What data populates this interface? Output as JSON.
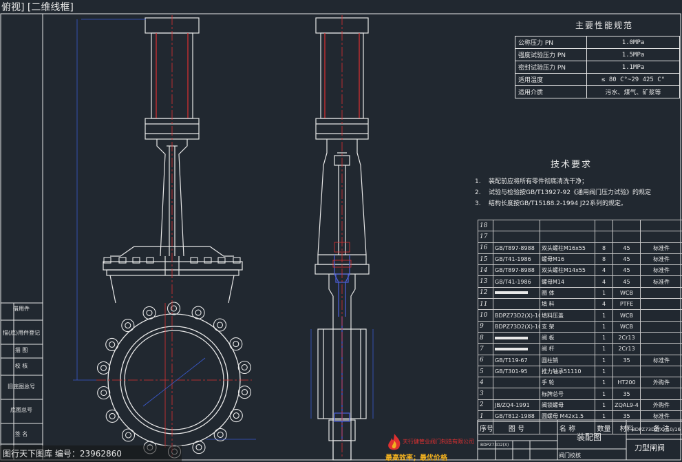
{
  "viewport_label": "俯视] [二维线框]",
  "spec_table": {
    "title": "主要性能规范",
    "rows": [
      {
        "label": "公称压力  PN",
        "value": "1.0MPa"
      },
      {
        "label": "强度试验压力 PN",
        "value": "1.5MPa"
      },
      {
        "label": "密封试验压力 PN",
        "value": "1.1MPa"
      },
      {
        "label": "适用温度",
        "value": "≤ 80 C°~29  425 C°"
      },
      {
        "label": "适用介质",
        "value": "污水、煤气、矿浆等"
      }
    ]
  },
  "tech": {
    "title": "技术要求",
    "items": [
      {
        "n": "1.",
        "text": "装配前应将所有零件彻底清洗干净；"
      },
      {
        "n": "2.",
        "text": "试验与检验按GB/T13927-92《通用阀门压力试验》的规定"
      },
      {
        "n": "3.",
        "text": "结构长度按GB/T15188.2-1994 J22系列的规定。"
      }
    ]
  },
  "bom": {
    "rows": [
      {
        "no": "18",
        "code": "",
        "name": "",
        "qty": "",
        "mat": "",
        "note": ""
      },
      {
        "no": "17",
        "code": "",
        "name": "",
        "qty": "",
        "mat": "",
        "note": ""
      },
      {
        "no": "16",
        "code": "GB/T897-8988",
        "name": "双头螺柱M16x55",
        "qty": "8",
        "mat": "45",
        "note": "标准件"
      },
      {
        "no": "15",
        "code": "GB/T41-1986",
        "name": "螺母M16",
        "qty": "8",
        "mat": "45",
        "note": "标准件"
      },
      {
        "no": "14",
        "code": "GB/T897-8988",
        "name": "双头螺柱M14x55",
        "qty": "4",
        "mat": "45",
        "note": "标准件"
      },
      {
        "no": "13",
        "code": "GB/T41-1986",
        "name": "螺母M14",
        "qty": "4",
        "mat": "45",
        "note": "标准件"
      },
      {
        "no": "12",
        "code": "",
        "name": "圈  体",
        "qty": "1",
        "mat": "WCB",
        "note": ""
      },
      {
        "no": "11",
        "code": "",
        "name": "填  料",
        "qty": "4",
        "mat": "PTFE",
        "note": ""
      },
      {
        "no": "10",
        "code": "BDPZ73D2(X)-10/16",
        "name": "填料压盖",
        "qty": "1",
        "mat": "WCB",
        "note": ""
      },
      {
        "no": "9",
        "code": "BDPZ73D2(X)-10/16",
        "name": "支  架",
        "qty": "1",
        "mat": "WCB",
        "note": ""
      },
      {
        "no": "8",
        "code": "",
        "name": "阀  板",
        "qty": "1",
        "mat": "2Cr13",
        "note": ""
      },
      {
        "no": "7",
        "code": "",
        "name": "阀  杆",
        "qty": "1",
        "mat": "2Cr13",
        "note": ""
      },
      {
        "no": "6",
        "code": "GB/T119-67",
        "name": "圆柱销",
        "qty": "1",
        "mat": "35",
        "note": "标准件"
      },
      {
        "no": "5",
        "code": "GB/T301-95",
        "name": "推力轴承51110",
        "qty": "1",
        "mat": "",
        "note": ""
      },
      {
        "no": "4",
        "code": "",
        "name": "手  轮",
        "qty": "1",
        "mat": "HT200",
        "note": "外购件"
      },
      {
        "no": "3",
        "code": "",
        "name": "标牌总号",
        "qty": "1",
        "mat": "35",
        "note": ""
      },
      {
        "no": "2",
        "code": "JB/ZQ4-1991",
        "name": "阀锁螺母",
        "qty": "1",
        "mat": "ZQAL9-4",
        "note": "外购件"
      },
      {
        "no": "1",
        "code": "GB/T812-1988",
        "name": "圆螺母 M42x1.5",
        "qty": "1",
        "mat": "35",
        "note": "标准件"
      }
    ],
    "header": {
      "no": "序号",
      "code": "图  号",
      "name": "名  称",
      "qty": "数量",
      "mat": "材料",
      "note": "备  注"
    },
    "bar_rows": [
      "12",
      "8",
      "7"
    ]
  },
  "title_block": {
    "drawing_title": "装配图",
    "drawing_code": "BDPZ73D2(X)-10/16",
    "part_name": "刀型闸阀",
    "small1": "BDPZ73D2(X)",
    "small2": "阀门校核"
  },
  "side_labels": [
    "借用件",
    "描(底)用件登记",
    "描  图",
    "校  核",
    "旧底图总号",
    "底图总号",
    "签  名"
  ],
  "company": {
    "name": "天行健管业阀门制造有限公司",
    "slogan": "最高效率；最优价格"
  },
  "watermark": "图行天下图库  编号：23962860",
  "colors": {
    "background": "#212830",
    "outline": "#e8e8e8",
    "centerline": "#e03030",
    "hidden": "#4a5cd0",
    "dimension": "#3a5ad0"
  }
}
